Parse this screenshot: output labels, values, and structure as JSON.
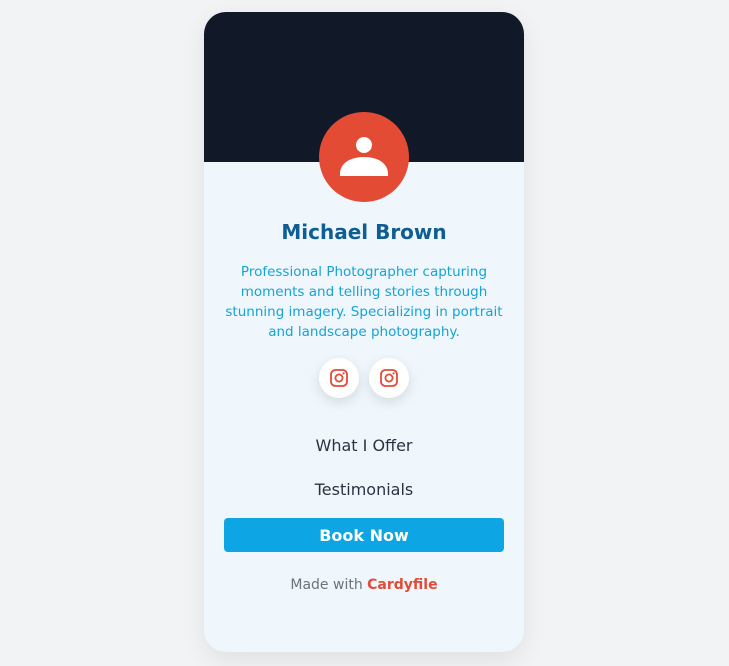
{
  "profile": {
    "name": "Michael Brown",
    "bio": "Professional Photographer capturing moments and telling stories through stunning imagery. Specializing in portrait and landscape photography."
  },
  "socials": [
    {
      "icon": "instagram-icon"
    },
    {
      "icon": "instagram-icon"
    }
  ],
  "menu": {
    "offer": "What I Offer",
    "testimonials": "Testimonials",
    "book": "Book Now"
  },
  "footer": {
    "prefix": "Made with",
    "brand": "Cardyfile"
  },
  "colors": {
    "cover": "#111827",
    "accent": "#e34b35",
    "primary": "#0ea5e4",
    "name": "#0f5e93",
    "bio": "#16a3d6",
    "card": "#eff7fd"
  }
}
